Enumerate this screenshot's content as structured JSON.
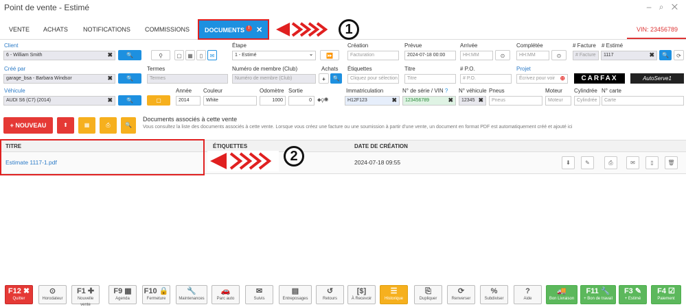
{
  "window": {
    "title": "Point de vente - Estimé",
    "controls": "– ⌕ ✕"
  },
  "tabs": [
    {
      "label": "VENTE"
    },
    {
      "label": "ACHATS"
    },
    {
      "label": "NOTIFICATIONS"
    },
    {
      "label": "COMMISSIONS"
    },
    {
      "label": "DOCUMENTS",
      "badge": "!"
    }
  ],
  "vin_tab": "VIN: 23456789",
  "form": {
    "client_label": "Client",
    "client_value": "6 - William Smith",
    "etape_label": "Étape",
    "etape_value": "1 - Estimé",
    "creation_label": "Création",
    "creation_placeholder": "Facturation",
    "prevue_label": "Prévue",
    "prevue_value": "2024-07-18 00:00",
    "arrivee_label": "Arrivée",
    "arrivee_placeholder": "HH:MM",
    "completee_label": "Complétée",
    "completee_placeholder": "HH:MM",
    "facture_label": "# Facture",
    "facture_placeholder": "# Facture",
    "estime_label": "# Estimé",
    "estime_value": "1117",
    "cree_par_label": "Créé par",
    "cree_par_value": "garage_bsa - Barbara Windsor",
    "termes_label": "Termes",
    "termes_placeholder": "Termes",
    "membre_label": "Numéro de membre (Club)",
    "membre_placeholder": "Numéro de membre (Club)",
    "achats_label": "Achats",
    "etiquettes_label": "Étiquettes",
    "etiquettes_placeholder": "Cliquez pour sélection",
    "titre_label": "Titre",
    "titre_placeholder": "Titre",
    "po_label": "# P.O.",
    "po_placeholder": "# P.O.",
    "projet_label": "Projet",
    "projet_placeholder": "Écrivez pour voir",
    "vehicule_label": "Véhicule",
    "vehicule_value": "AUDI S6 (C7) (2014)",
    "annee_label": "Année",
    "annee_value": "2014",
    "couleur_label": "Couleur",
    "couleur_value": "White",
    "odometre_label": "Odomètre",
    "odometre_value": "1000",
    "sortie_label": "Sortie",
    "sortie_value": "0",
    "immat_label": "Immatriculation",
    "immat_value": "H12F123",
    "serie_label": "N° de série / VIN",
    "serie_value": "123456789",
    "nveh_label": "N° véhicule",
    "nveh_value": "12345",
    "pneus_label": "Pneus",
    "pneus_placeholder": "Pneus",
    "moteur_label": "Moteur",
    "moteur_placeholder": "Moteur",
    "cylindree_label": "Cylindrée",
    "cylindree_placeholder": "Cylindrée",
    "carte_label": "N° carte",
    "carte_placeholder": "Carte"
  },
  "logos": {
    "carfax": "CARFAX",
    "autoserve": "AutoServe1"
  },
  "toolbar": {
    "nouveau_label": "+ NOUVEAU"
  },
  "documents": {
    "title": "Documents associés à cette vente",
    "description": "Vous consultez la liste des documents associés à cette vente. Lorsque vous créez une facture ou une soumission à partir d'une vente, un document en format PDF est automatiquement créé et ajouté ici",
    "columns": [
      "TITRE",
      "ÉTIQUETTES",
      "DATE DE CRÉATION"
    ],
    "rows": [
      {
        "titre": "Estimate 1117-1.pdf",
        "date": "2024-07-18 09:55"
      }
    ]
  },
  "callouts": [
    "1",
    "2"
  ],
  "fkeys": [
    {
      "key": "F12 ✖",
      "label": "Quitter",
      "style": "red"
    },
    {
      "key": "⊙",
      "label": "Horodateur",
      "style": ""
    },
    {
      "key": "F1 ✚",
      "label": "Nouvelle vente",
      "style": ""
    },
    {
      "key": "F9 ▦",
      "label": "Agenda",
      "style": ""
    },
    {
      "key": "F10 🔒",
      "label": "Fermeture",
      "style": ""
    },
    {
      "key": "🔧",
      "label": "Maintenances",
      "style": ""
    },
    {
      "key": "🚗",
      "label": "Parc auto",
      "style": ""
    },
    {
      "key": "✉",
      "label": "Suivis",
      "style": ""
    },
    {
      "key": "▤",
      "label": "Entreposages",
      "style": ""
    },
    {
      "key": "↺",
      "label": "Retours",
      "style": ""
    },
    {
      "key": "[$]",
      "label": "À Recevoir",
      "style": ""
    },
    {
      "key": "☰",
      "label": "Historique",
      "style": "orange"
    },
    {
      "key": "⎘",
      "label": "Dupliquer",
      "style": ""
    },
    {
      "key": "⟳",
      "label": "Renverser",
      "style": ""
    },
    {
      "key": "%",
      "label": "Subdiviser",
      "style": ""
    },
    {
      "key": "?",
      "label": "Aide",
      "style": ""
    },
    {
      "key": "🚚",
      "label": "Bon Livraison",
      "style": "green"
    },
    {
      "key": "F11 🔧",
      "label": "+ Bon de travail",
      "style": "green"
    },
    {
      "key": "F3 ✎",
      "label": "+ Estimé",
      "style": "green"
    },
    {
      "key": "F4 ☑",
      "label": "Paiement",
      "style": "green"
    }
  ],
  "colors": {
    "accent": "#1d90e0",
    "danger": "#e53935",
    "warning": "#f6b01e",
    "success": "#5cb85c"
  }
}
